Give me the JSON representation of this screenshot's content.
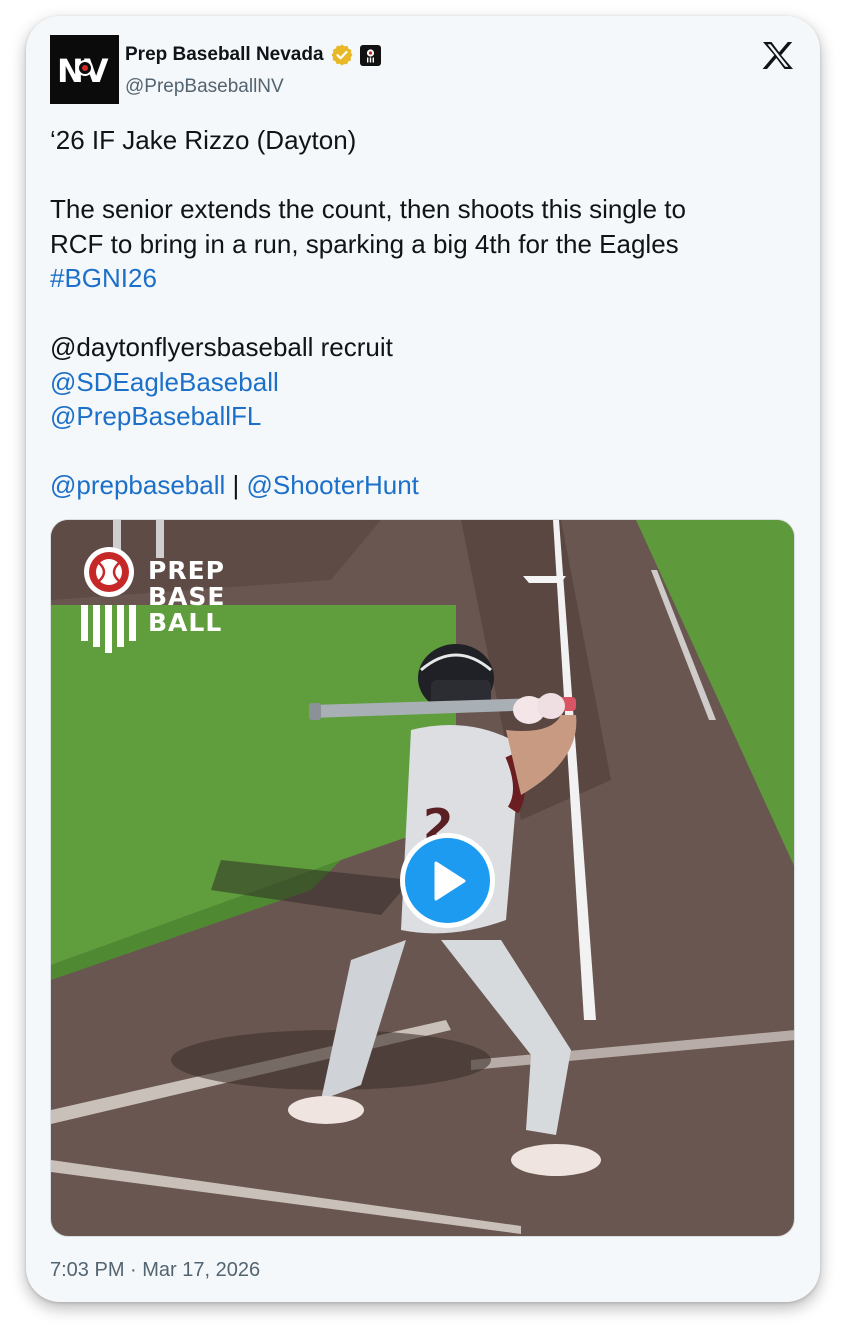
{
  "author": {
    "name": "Prep Baseball Nevada",
    "handle": "@PrepBaseballNV",
    "avatar_text": "NV"
  },
  "tweet": {
    "line1": "‘26 IF Jake Rizzo (Dayton)",
    "line2": "The senior extends the count, then shoots this single to",
    "line3": "RCF to bring in a run, sparking a big 4th for the Eagles",
    "hashtag": "#BGNI26",
    "line5": "@daytonflyersbaseball recruit",
    "mention1": "@SDEagleBaseball",
    "mention2": "@PrepBaseballFL",
    "mention3": "@prepbaseball",
    "separator": "|",
    "mention4": "@ShooterHunt"
  },
  "media": {
    "logo_line1": "PREP",
    "logo_line2": "BASE",
    "logo_line3": "BALL",
    "jersey_number": "2"
  },
  "timestamp": "7:03 PM · Mar 17, 2026",
  "colors": {
    "link": "#1d70c9",
    "verified": "#e8b829",
    "play_button": "#1d9bf0",
    "card_bg": "#f5f8fa"
  },
  "icons": [
    "verified-badge-icon",
    "affiliate-badge-icon",
    "x-logo-icon",
    "play-icon"
  ]
}
